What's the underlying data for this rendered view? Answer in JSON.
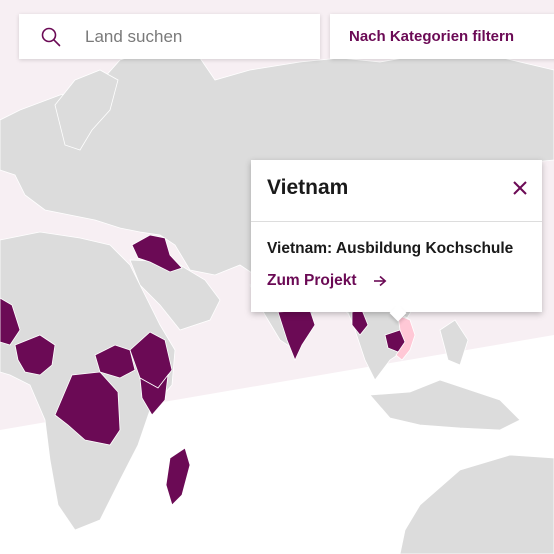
{
  "colors": {
    "accent": "#6b0a55",
    "land": "#dcdcdc",
    "highlight": "#ffc8d6",
    "ocean_tint": "#f7eff3"
  },
  "search": {
    "placeholder": "Land suchen",
    "icon": "search-icon"
  },
  "filter": {
    "label": "Nach Kategorien filtern"
  },
  "popup": {
    "country": "Vietnam",
    "close_icon": "close-icon",
    "project_name": "Vietnam: Ausbildung Kochschule",
    "link_label": "Zum Projekt",
    "link_icon": "arrow-right-icon"
  }
}
